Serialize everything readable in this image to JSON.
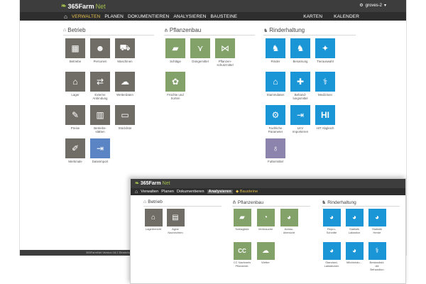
{
  "screen1": {
    "logo": {
      "brand": "365Farm",
      "suffix": "Net"
    },
    "user": "groves-2",
    "nav": {
      "items": [
        "VERWALTEN",
        "PLANEN",
        "DOKUMENTIEREN",
        "ANALYSIEREN",
        "BAUSTEINE"
      ],
      "active": "VERWALTEN",
      "right": [
        "KARTEN",
        "KALENDER"
      ]
    },
    "sections": {
      "betrieb": {
        "title": "Betrieb",
        "tiles": [
          "Betriebe",
          "Personen",
          "Maschinen",
          "Lager",
          "Externe\nAnbindung",
          "Wetterdaten",
          "Preise",
          "Betriebs-\nstätten",
          "Stückliste",
          "Merkmale",
          "Dateiimport"
        ]
      },
      "pflanzenbau": {
        "title": "Pflanzenbau",
        "tiles": [
          "Schläge",
          "Düngemittel",
          "Pflanzen-\nschutzmittel",
          "Früchte und\nSorten"
        ]
      },
      "rinderhaltung": {
        "title": "Rinderhaltung",
        "tiles": [
          "Rinder",
          "Besamung",
          "Tierauswahl",
          "Stammdaten",
          "Behand-\nlungsmittel",
          "Medizinen",
          "Fachliche\nParameter",
          "LKV\nImportieren",
          "HIT Abgleich",
          "Futtermittel"
        ]
      }
    },
    "footer": "365FarmNet Version 18.2 Einstellungen"
  },
  "screen2": {
    "logo": {
      "brand": "365Farm",
      "suffix": "Net"
    },
    "nav": {
      "items": [
        "Verwalten",
        "Planen",
        "Dokumentieren",
        "Analysieren"
      ],
      "active": "Analysieren",
      "extra": "Bausteine"
    },
    "sections": {
      "betrieb": {
        "title": "Betrieb",
        "tiles": [
          "Lagerbericht",
          "Agrar\nNachrichten"
        ]
      },
      "pflanzenbau": {
        "title": "Pflanzenbau",
        "tiles": [
          "Schlagliste",
          "Verbrauche",
          "Anbau-\nübersicht",
          "CC Nachweis\nPflanzenb.",
          "Wetter"
        ]
      },
      "rinderhaltung": {
        "title": "Rinderhaltung",
        "tiles": [
          "Repro-\nSchnitte",
          "Statistik\nLaktation",
          "Statistik\nHerde",
          "Standard-\nLaktationen",
          "Milchleistu...",
          "Bestandsbl.\ndie\nBehandlun"
        ]
      }
    }
  },
  "colors": {
    "topbar": "#3d3d3d",
    "navbar": "#2e2e2e",
    "accent": "#e7c14f",
    "betrieb": "#706d66",
    "pflanzenbau": "#82a26a",
    "rinderhaltung": "#1a95d6"
  }
}
